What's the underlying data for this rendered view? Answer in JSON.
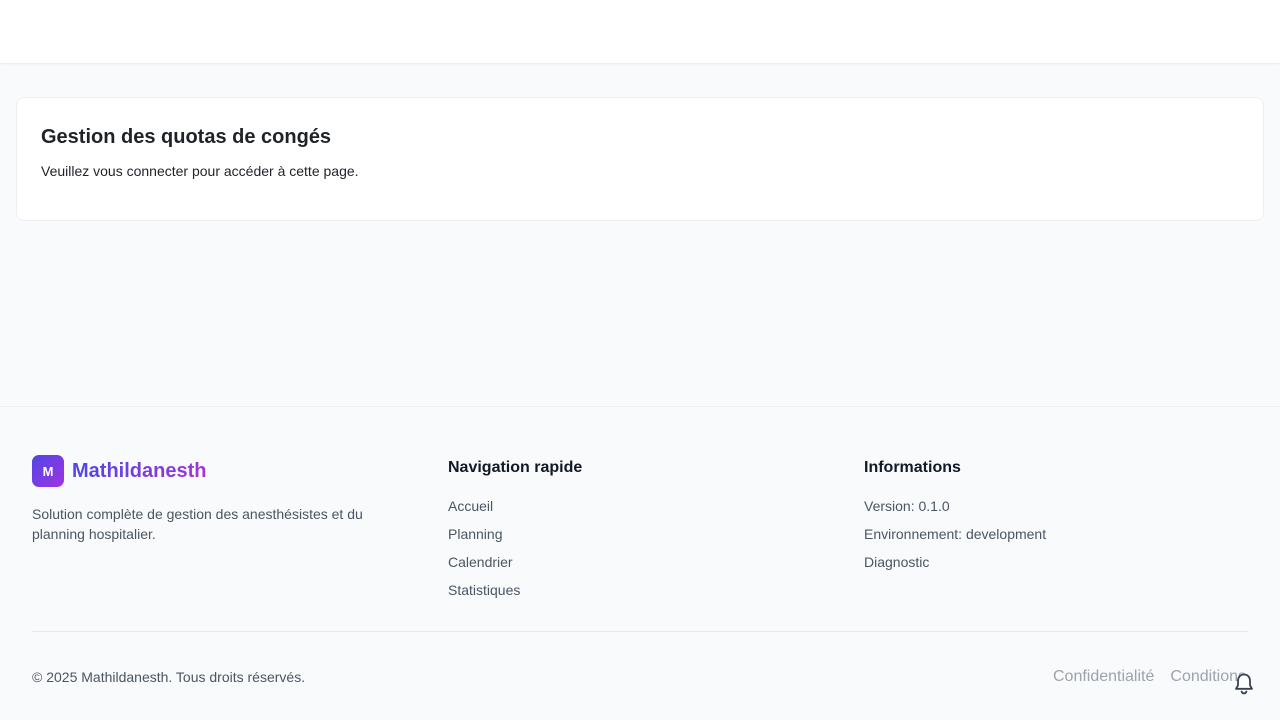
{
  "card": {
    "title": "Gestion des quotas de congés",
    "message": "Veuillez vous connecter pour accéder à cette page."
  },
  "footer": {
    "brand": {
      "initial": "M",
      "name": "Mathildanesth",
      "description": "Solution complète de gestion des anesthésistes et du planning hospitalier."
    },
    "navigation": {
      "title": "Navigation rapide",
      "links": [
        "Accueil",
        "Planning",
        "Calendrier",
        "Statistiques"
      ]
    },
    "informations": {
      "title": "Informations",
      "items": [
        "Version: 0.1.0",
        "Environnement: development",
        "Diagnostic"
      ]
    },
    "copyright": "© 2025 Mathildanesth. Tous droits réservés.",
    "legal_links": [
      "Confidentialité",
      "Conditions"
    ]
  },
  "icons": {
    "notification": "bell-icon"
  },
  "colors": {
    "brand_start": "#4f46e5",
    "brand_end": "#a033e0"
  }
}
